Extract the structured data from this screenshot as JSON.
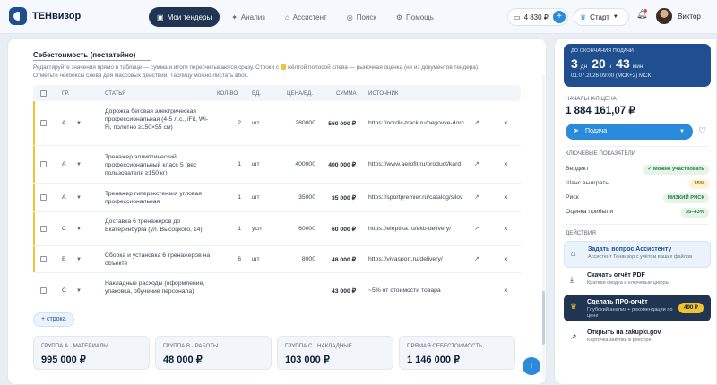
{
  "app": {
    "brand": "ТЕНвизор"
  },
  "nav": [
    {
      "label": "Мои тендеры",
      "icon": "briefcase-icon",
      "glyph": "▣"
    },
    {
      "label": "Анализ",
      "icon": "sparkle-icon",
      "glyph": "✦"
    },
    {
      "label": "Ассистент",
      "icon": "robot-icon",
      "glyph": "⌂"
    },
    {
      "label": "Поиск",
      "icon": "compass-icon",
      "glyph": "◎"
    },
    {
      "label": "Помощь",
      "icon": "gear-icon",
      "glyph": "⚙"
    }
  ],
  "header": {
    "balance": "4 830 ₽",
    "plan": "Старт",
    "user": "Виктор"
  },
  "section": {
    "title": "Себестоимость (постатейно)",
    "desc_part1": "Редактируйте значения прямо в таблице — сумма и итоги пересчитываются сразу. Строки с",
    "desc_part2": "жёлтой полосой слева — рыночная оценка (не из документов тендера).",
    "desc_part3": "Отметьте чекбоксы слева для массовых действий. Таблицу можно листать вбок."
  },
  "table": {
    "headers": {
      "group": "ГР.",
      "item": "Статья",
      "qty": "Кол-во",
      "unit": "Ед.",
      "price": "Цена/ед.",
      "sum": "Сумма",
      "source": "Источник"
    },
    "rows": [
      {
        "group": "А",
        "name": "Дорожка беговая электрическая профессиональная (4-5 л.с., iFit, Wi-Fi, полотно ≥150×55 см)",
        "qty": "2",
        "unit": "шт",
        "price": "280000",
        "sum": "560 000 ₽",
        "source": "https://nordic-track.ru/begovye-dorc"
      },
      {
        "group": "А",
        "name": "Тренажер эллиптический профессиональный класс 5 (вес пользователя ≥150 кг)",
        "qty": "1",
        "unit": "шт",
        "price": "400000",
        "sum": "400 000 ₽",
        "source": "https://www.aerofit.ru/product/kard"
      },
      {
        "group": "А",
        "name": "Тренажер гиперэкстензия угловая профессиональная",
        "qty": "1",
        "unit": "шт",
        "price": "35000",
        "sum": "35 000 ₽",
        "source": "https://sportpremier.ru/catalog/silov"
      },
      {
        "group": "С",
        "name": "Доставка 6 тренажеров до Екатеринбурга (ул. Высоцкого, 14)",
        "qty": "1",
        "unit": "усл",
        "price": "60000",
        "sum": "60 000 ₽",
        "source": "https://eleptika.ru/ekb-delivery/"
      },
      {
        "group": "В",
        "name": "Сборка и установка 6 тренажеров на объекте",
        "qty": "6",
        "unit": "шт",
        "price": "8000",
        "sum": "48 000 ₽",
        "source": "https://vivasport.ru/delivery/"
      },
      {
        "group": "С",
        "name": "Накладные расходы (оформление, упаковка, обучение персонала)",
        "qty": "",
        "unit": "",
        "price": "",
        "sum": "43 000 ₽",
        "source": "~5% от стоимости товара"
      }
    ]
  },
  "add_row": "+ строка",
  "totals": [
    {
      "label": "Группа А · материалы",
      "value": "995 000 ₽"
    },
    {
      "label": "Группа В · работы",
      "value": "48 000 ₽"
    },
    {
      "label": "Группа С · накладные",
      "value": "103 000 ₽"
    },
    {
      "label": "Прямая себестоимость",
      "value": "1 146 000 ₽"
    }
  ],
  "side": {
    "deadline_label": "До окончания подачи",
    "days": "3",
    "days_unit": "дн",
    "hours": "20",
    "hours_unit": "ч",
    "minutes": "43",
    "minutes_unit": "мин",
    "deadline_date": "01.07.2026 09:00 (МСК+2) МСК",
    "price_label": "Начальная цена",
    "price": "1 884 161,07 ₽",
    "submit": "Подача",
    "kp_title": "Ключевые показатели",
    "kp": [
      {
        "label": "Вердикт",
        "value": "Можно участвовать",
        "tone": "green"
      },
      {
        "label": "Шанс выиграть",
        "value": "35%",
        "tone": "yellow"
      },
      {
        "label": "Риск",
        "value": "НИЗКИЙ РИСК",
        "tone": "green"
      },
      {
        "label": "Оценка прибыли",
        "value": "35–43%",
        "tone": "green"
      }
    ],
    "actions_title": "Действия",
    "actions": [
      {
        "title": "Задать вопрос Ассистенту",
        "sub": "Ассистент Тенвизор с учётом ваших файлов"
      },
      {
        "title": "Скачать отчёт PDF",
        "sub": "Краткая сводка и ключевые цифры"
      },
      {
        "title": "Сделать ПРО-отчёт",
        "sub": "Глубокий анализ + рекомендации по цене",
        "price": "490 ₽"
      },
      {
        "title": "Открыть на zakupki.gov",
        "sub": "Карточка закупки в реестре"
      }
    ]
  },
  "colors": {
    "accent": "#2b8ad9",
    "dark": "#1f3552",
    "brand": "#1f4f8f",
    "market_marker": "#f1c232"
  }
}
